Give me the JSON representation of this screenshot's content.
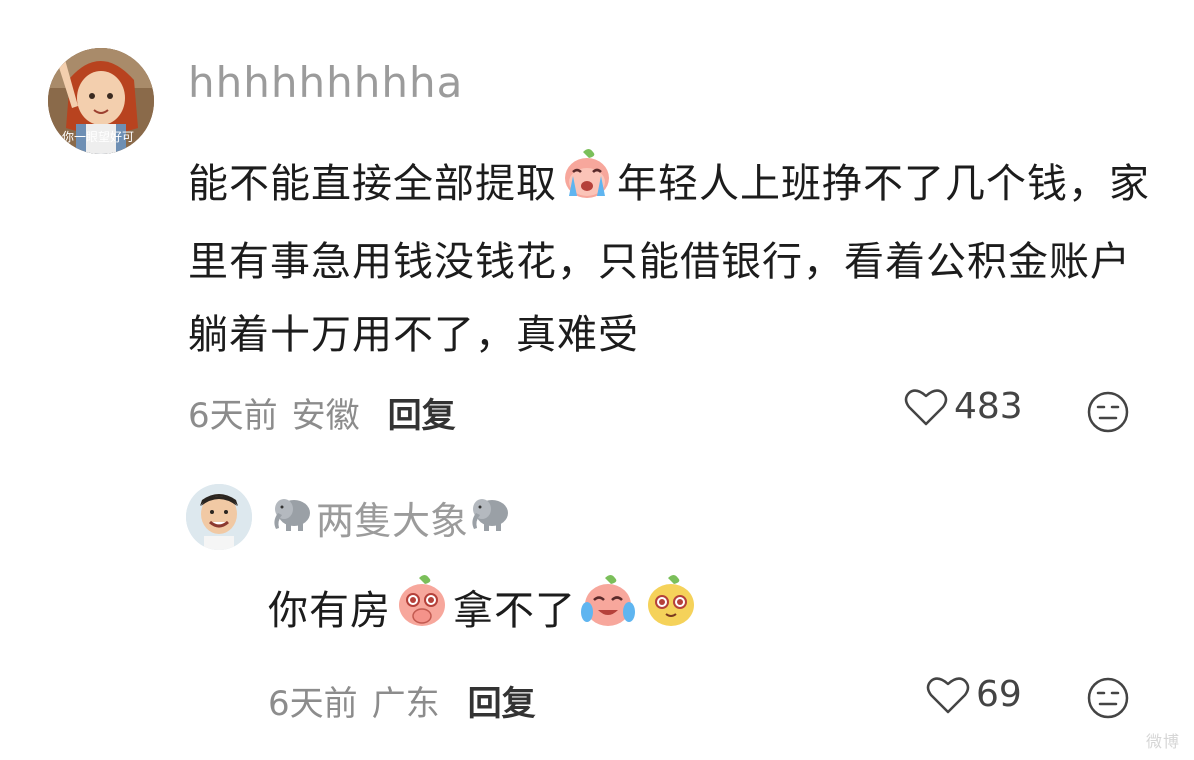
{
  "comments": [
    {
      "username": "hhhhhhhhha",
      "text_parts": [
        "能不能直接全部提取",
        "年轻人上班挣不了几个钱，家里有事急用钱没钱花，只能借银行，看着公积金账户躺着十万用不了，真难受"
      ],
      "time": "6天前",
      "location": "安徽",
      "reply_label": "回复",
      "likes": "483"
    },
    {
      "username": "两隻大象",
      "text_parts": [
        "你有房",
        "拿不了"
      ],
      "time": "6天前",
      "location": "广东",
      "reply_label": "回复",
      "likes": "69"
    }
  ],
  "avatar_caption": "你一眼望好可",
  "watermark": "微博"
}
